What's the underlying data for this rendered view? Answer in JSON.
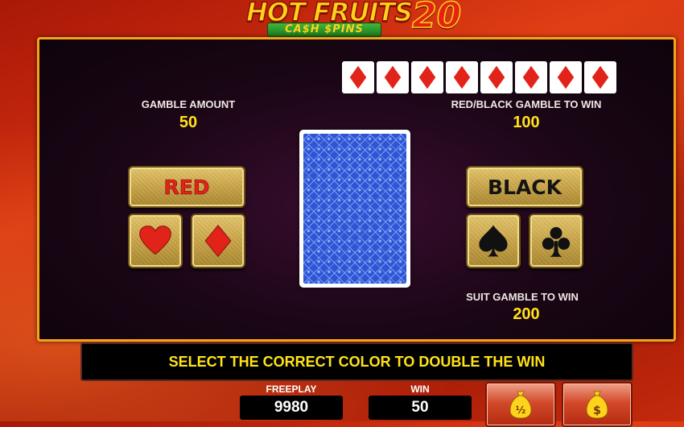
{
  "logo": {
    "title": "HOT FRUITS",
    "number": "20",
    "subtitle": "CA$H $PINS"
  },
  "gamble": {
    "amount_label": "GAMBLE AMOUNT",
    "amount_value": "50",
    "redblack_label": "RED/BLACK GAMBLE TO WIN",
    "redblack_value": "100",
    "suit_label": "SUIT GAMBLE TO WIN",
    "suit_value": "200"
  },
  "history": [
    "diamond",
    "diamond",
    "diamond",
    "diamond",
    "diamond",
    "diamond",
    "diamond",
    "diamond"
  ],
  "buttons": {
    "red_label": "RED",
    "black_label": "BLACK"
  },
  "suits": {
    "hearts": "heart-icon",
    "diamonds": "diamond-icon",
    "spades": "spade-icon",
    "clubs": "club-icon"
  },
  "message": "SELECT THE CORRECT COLOR TO DOUBLE THE WIN",
  "stats": {
    "freeplay_label": "FREEPLAY",
    "freeplay_value": "9980",
    "win_label": "WIN",
    "win_value": "50"
  },
  "bag_buttons": {
    "half": "½",
    "full": "$"
  },
  "colors": {
    "accent": "#f5a31b",
    "value_yellow": "#ffe21a",
    "suit_red": "#e2231a",
    "gold": "#c9a447"
  }
}
